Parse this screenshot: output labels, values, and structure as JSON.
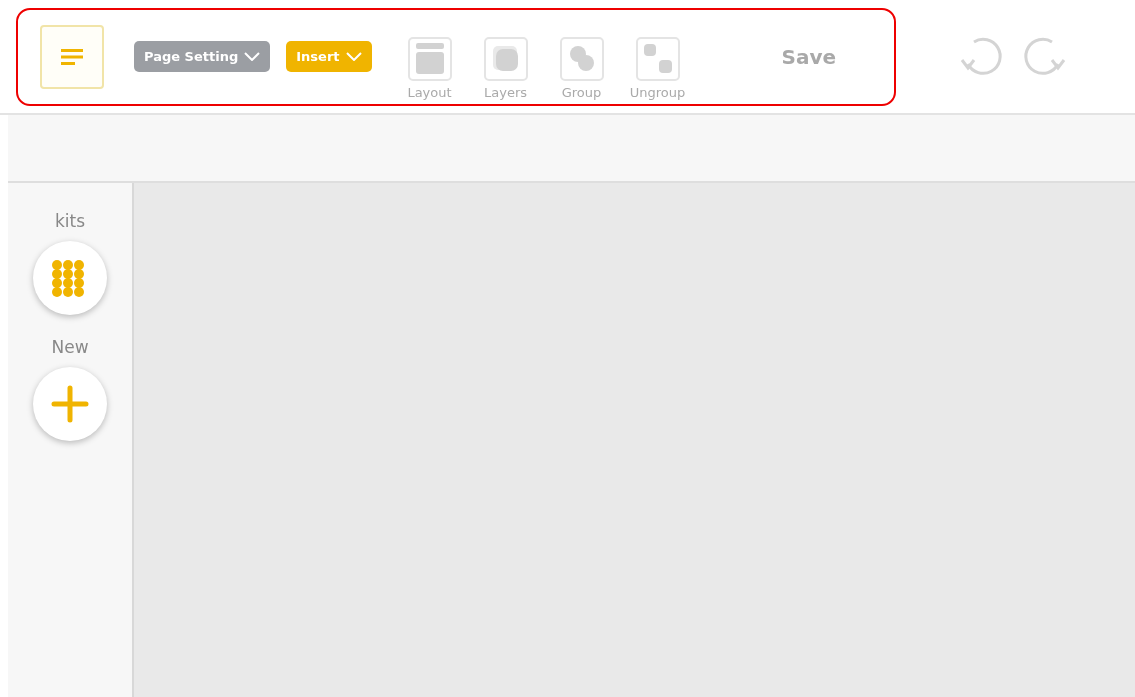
{
  "toolbar": {
    "menus": [
      {
        "label": "Page Setting",
        "kind": "neutral"
      },
      {
        "label": "Insert",
        "kind": "accent"
      }
    ],
    "tools": [
      {
        "label": "Layout",
        "kind": "layout",
        "disabled": true
      },
      {
        "label": "Layers",
        "kind": "layers",
        "disabled": true
      },
      {
        "label": "Group",
        "kind": "group",
        "disabled": true
      },
      {
        "label": "Ungroup",
        "kind": "ungroup",
        "disabled": true
      }
    ],
    "save": {
      "label": "Save",
      "disabled": true
    },
    "history": [
      {
        "kind": "undo",
        "disabled": true
      },
      {
        "kind": "redo",
        "disabled": true
      }
    ]
  },
  "sidebar": {
    "items": [
      {
        "label": "kits",
        "kind": "kits"
      },
      {
        "label": "New",
        "kind": "new"
      }
    ]
  }
}
